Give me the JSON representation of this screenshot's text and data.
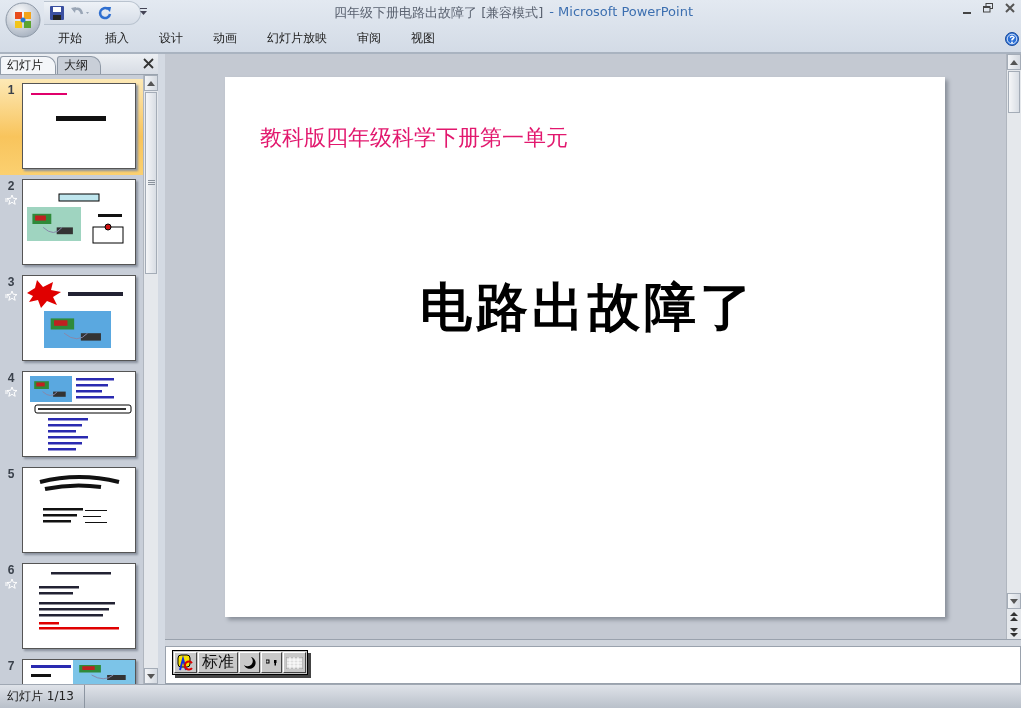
{
  "window": {
    "title": "四年级下册电路出故障了 [兼容模式]",
    "app_name": "- Microsoft PowerPoint"
  },
  "ribbon_tabs": [
    {
      "label": "开始"
    },
    {
      "label": "插入"
    },
    {
      "label": "设计"
    },
    {
      "label": "动画"
    },
    {
      "label": "幻灯片放映"
    },
    {
      "label": "审阅"
    },
    {
      "label": "视图"
    }
  ],
  "panel_tabs": [
    {
      "label": "幻灯片",
      "selected": true
    },
    {
      "label": "大纲",
      "selected": false
    }
  ],
  "thumbnails": [
    {
      "number": "1",
      "selected": true,
      "animated": false
    },
    {
      "number": "2",
      "selected": false,
      "animated": true
    },
    {
      "number": "3",
      "selected": false,
      "animated": true
    },
    {
      "number": "4",
      "selected": false,
      "animated": true
    },
    {
      "number": "5",
      "selected": false,
      "animated": false
    },
    {
      "number": "6",
      "selected": false,
      "animated": true
    },
    {
      "number": "7",
      "selected": false,
      "animated": false
    }
  ],
  "slide": {
    "subtitle": "教科版四年级科学下册第一单元",
    "title": "电路出故障了"
  },
  "ime_bar": {
    "mode": "标准"
  },
  "status_bar": {
    "slide_counter": "幻灯片 1/13"
  }
}
